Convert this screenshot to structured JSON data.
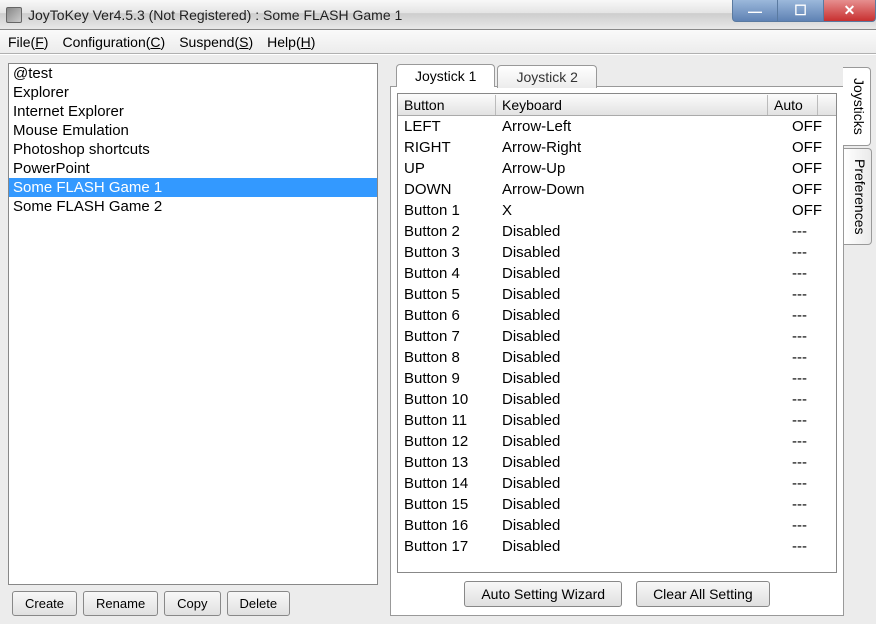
{
  "window": {
    "title": "JoyToKey Ver4.5.3 (Not Registered) : Some FLASH Game 1"
  },
  "menu": {
    "file": "File(F)",
    "configuration": "Configuration(C)",
    "suspend": "Suspend(S)",
    "help": "Help(H)"
  },
  "profiles": [
    {
      "name": "@test",
      "selected": false
    },
    {
      "name": "Explorer",
      "selected": false
    },
    {
      "name": "Internet Explorer",
      "selected": false
    },
    {
      "name": "Mouse Emulation",
      "selected": false
    },
    {
      "name": "Photoshop shortcuts",
      "selected": false
    },
    {
      "name": "PowerPoint",
      "selected": false
    },
    {
      "name": "Some FLASH Game 1",
      "selected": true
    },
    {
      "name": "Some FLASH Game 2",
      "selected": false
    }
  ],
  "profile_buttons": {
    "create": "Create",
    "rename": "Rename",
    "copy": "Copy",
    "delete": "Delete"
  },
  "joystick_tabs": [
    {
      "label": "Joystick 1",
      "active": true
    },
    {
      "label": "Joystick 2",
      "active": false
    }
  ],
  "columns": {
    "button": "Button",
    "keyboard": "Keyboard",
    "auto": "Auto"
  },
  "mappings": [
    {
      "button": "LEFT",
      "keyboard": "Arrow-Left",
      "auto": "OFF"
    },
    {
      "button": "RIGHT",
      "keyboard": "Arrow-Right",
      "auto": "OFF"
    },
    {
      "button": "UP",
      "keyboard": "Arrow-Up",
      "auto": "OFF"
    },
    {
      "button": "DOWN",
      "keyboard": "Arrow-Down",
      "auto": "OFF"
    },
    {
      "button": "Button 1",
      "keyboard": "X",
      "auto": "OFF"
    },
    {
      "button": "Button 2",
      "keyboard": "Disabled",
      "auto": "---"
    },
    {
      "button": "Button 3",
      "keyboard": "Disabled",
      "auto": "---"
    },
    {
      "button": "Button 4",
      "keyboard": "Disabled",
      "auto": "---"
    },
    {
      "button": "Button 5",
      "keyboard": "Disabled",
      "auto": "---"
    },
    {
      "button": "Button 6",
      "keyboard": "Disabled",
      "auto": "---"
    },
    {
      "button": "Button 7",
      "keyboard": "Disabled",
      "auto": "---"
    },
    {
      "button": "Button 8",
      "keyboard": "Disabled",
      "auto": "---"
    },
    {
      "button": "Button 9",
      "keyboard": "Disabled",
      "auto": "---"
    },
    {
      "button": "Button 10",
      "keyboard": "Disabled",
      "auto": "---"
    },
    {
      "button": "Button 11",
      "keyboard": "Disabled",
      "auto": "---"
    },
    {
      "button": "Button 12",
      "keyboard": "Disabled",
      "auto": "---"
    },
    {
      "button": "Button 13",
      "keyboard": "Disabled",
      "auto": "---"
    },
    {
      "button": "Button 14",
      "keyboard": "Disabled",
      "auto": "---"
    },
    {
      "button": "Button 15",
      "keyboard": "Disabled",
      "auto": "---"
    },
    {
      "button": "Button 16",
      "keyboard": "Disabled",
      "auto": "---"
    },
    {
      "button": "Button 17",
      "keyboard": "Disabled",
      "auto": "---"
    }
  ],
  "bottom_buttons": {
    "wizard": "Auto Setting Wizard",
    "clear": "Clear All Setting"
  },
  "side_tabs": {
    "joysticks": "Joysticks",
    "preferences": "Preferences"
  }
}
